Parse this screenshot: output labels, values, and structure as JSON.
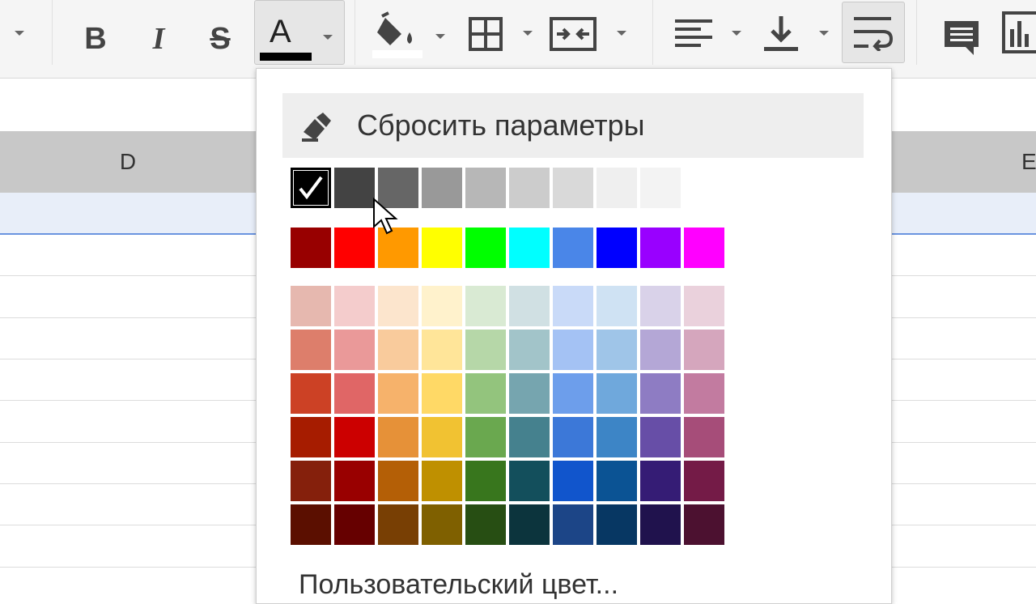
{
  "toolbar": {
    "bold_label": "B",
    "italic_label": "I",
    "strike_label": "S",
    "text_color_label": "A",
    "text_color_value": "#000000",
    "fill_color_value": "#ffffff",
    "icons": [
      "caret-down-icon",
      "bold-icon",
      "italic-icon",
      "strikethrough-icon",
      "text-color-icon",
      "fill-color-icon",
      "borders-icon",
      "merge-cells-icon",
      "align-left-icon",
      "valign-bottom-icon",
      "wrap-text-icon",
      "comment-icon",
      "chart-icon"
    ]
  },
  "sheet": {
    "column_d": "D",
    "column_e": "E",
    "selection_color": "#6a94e0"
  },
  "color_menu": {
    "reset_label": "Сбросить параметры",
    "custom_label": "Пользовательский цвет...",
    "selected_color": "#000000",
    "palette": {
      "grays": [
        "#000000",
        "#434343",
        "#666666",
        "#999999",
        "#b7b7b7",
        "#cccccc",
        "#d9d9d9",
        "#efefef",
        "#f3f3f3"
      ],
      "bright": [
        "#980000",
        "#ff0000",
        "#ff9900",
        "#ffff00",
        "#00ff00",
        "#00ffff",
        "#4a86e8",
        "#0000ff",
        "#9900ff",
        "#ff00ff"
      ],
      "shades": [
        [
          "#e6b8af",
          "#f4cccc",
          "#fce5cd",
          "#fff2cc",
          "#d9ead3",
          "#d0e0e3",
          "#c9daf8",
          "#cfe2f3",
          "#d9d2e9",
          "#ead1dc"
        ],
        [
          "#dd7e6b",
          "#ea9999",
          "#f9cb9c",
          "#ffe599",
          "#b6d7a8",
          "#a2c4c9",
          "#a4c2f4",
          "#9fc5e8",
          "#b4a7d6",
          "#d5a6bd"
        ],
        [
          "#cc4125",
          "#e06666",
          "#f6b26b",
          "#ffd966",
          "#93c47d",
          "#76a5af",
          "#6d9eeb",
          "#6fa8dc",
          "#8e7cc3",
          "#c27ba0"
        ],
        [
          "#a61c00",
          "#cc0000",
          "#e69138",
          "#f1c232",
          "#6aa84f",
          "#45818e",
          "#3c78d8",
          "#3d85c6",
          "#674ea7",
          "#a64d79"
        ],
        [
          "#85200c",
          "#990000",
          "#b45f06",
          "#bf9000",
          "#38761d",
          "#134f5c",
          "#1155cc",
          "#0b5394",
          "#351c75",
          "#741b47"
        ],
        [
          "#5b0f00",
          "#660000",
          "#783f04",
          "#7f6000",
          "#274e13",
          "#0c343d",
          "#1c4587",
          "#073763",
          "#20124d",
          "#4c1130"
        ]
      ]
    }
  }
}
